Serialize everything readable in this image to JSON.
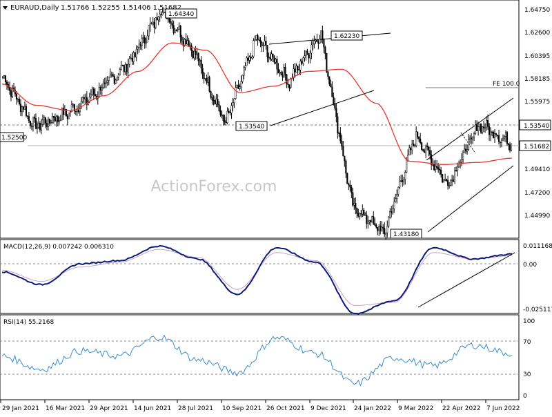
{
  "header": {
    "symbol": "EURAUD,Daily",
    "ohlc": "1.51766 1.52255 1.51406 1.51682"
  },
  "watermark": "ActionForex.com",
  "colors": {
    "candle": "#000000",
    "ma": "#e8352e",
    "macd": "#0a1a7a",
    "signal": "#c9a0c0",
    "rsi": "#3a8ccf",
    "grid_dash": "#888888"
  },
  "chart_data": [
    {
      "type": "candlestick",
      "title": "EURAUD,Daily",
      "ylim": [
        1.428,
        1.6512
      ],
      "price_ticks": [
        "1.64750",
        "1.62600",
        "1.60395",
        "1.58185",
        "1.55975",
        "1.53765",
        "1.51682",
        "1.49410",
        "1.47200",
        "1.44990"
      ],
      "x_ticks": [
        "29 Jan 2021",
        "16 Mar 2021",
        "29 Apr 2021",
        "14 Jun 2021",
        "28 Jul 2021",
        "10 Sep 2021",
        "26 Oct 2021",
        "9 Dec 2021",
        "24 Jan 2022",
        "9 Mar 2022",
        "22 Apr 2022",
        "7 Jun 2022"
      ],
      "current_price": "1.51682",
      "resistance_level": "1.53540",
      "left_level": "1.52500",
      "annotations": [
        "1.64340",
        "1.62230",
        "1.53540",
        "1.43180"
      ],
      "fe_label": "FE 100.0",
      "fe_level": 1.5728,
      "key_points": [
        {
          "date": "29 Jan 2021",
          "close": 1.58
        },
        {
          "date": "Feb 2021",
          "close": 1.533
        },
        {
          "date": "16 Mar 2021",
          "close": 1.545
        },
        {
          "date": "29 Apr 2021",
          "close": 1.566
        },
        {
          "date": "14 Jun 2021",
          "close": 1.594
        },
        {
          "date": "28 Jul 2021",
          "close": 1.6434
        },
        {
          "date": "10 Sep 2021",
          "close": 1.605
        },
        {
          "date": "26 Oct 2021",
          "close": 1.5354
        },
        {
          "date": "Nov 2021",
          "close": 1.617
        },
        {
          "date": "9 Dec 2021",
          "close": 1.575
        },
        {
          "date": "24 Jan 2022",
          "close": 1.6223
        },
        {
          "date": "Feb 2022",
          "close": 1.458
        },
        {
          "date": "9 Mar 2022",
          "close": 1.4318
        },
        {
          "date": "22 Apr 2022",
          "close": 1.525
        },
        {
          "date": "May 2022",
          "close": 1.478
        },
        {
          "date": "7 Jun 2022",
          "close": 1.5354
        },
        {
          "date": "Jun 2022",
          "close": 1.51682
        }
      ],
      "series": [
        {
          "name": "MA",
          "values": [
            1.573,
            1.553,
            1.548,
            1.562,
            1.585,
            1.612,
            1.605,
            1.565,
            1.571,
            1.585,
            1.587,
            1.555,
            1.5,
            1.497,
            1.499,
            1.503
          ]
        }
      ]
    },
    {
      "type": "line",
      "title": "MACD(12,26,9) 0.007242 0.006310",
      "ylim": [
        -0.0295,
        0.0152
      ],
      "y_ticks": [
        "0.011168",
        "0.00",
        "-0.025117"
      ],
      "series": [
        {
          "name": "MACD",
          "values": [
            -0.004,
            -0.012,
            0.001,
            0.003,
            0.012,
            0.004,
            -0.018,
            0.011,
            0.002,
            -0.03,
            -0.022,
            0.011,
            0.004,
            0.007
          ]
        },
        {
          "name": "Signal",
          "values": [
            -0.003,
            -0.01,
            -0.001,
            0.002,
            0.01,
            0.005,
            -0.015,
            0.008,
            0.003,
            -0.025,
            -0.023,
            0.008,
            0.004,
            0.006
          ]
        }
      ]
    },
    {
      "type": "line",
      "title": "RSI(14) 55.2168",
      "ylim": [
        0,
        100
      ],
      "y_ticks": [
        "100",
        "70",
        "30",
        "0"
      ],
      "series": [
        {
          "name": "RSI",
          "values": [
            52,
            36,
            58,
            52,
            75,
            47,
            32,
            74,
            55,
            18,
            50,
            40,
            65,
            55.2
          ]
        }
      ]
    }
  ]
}
